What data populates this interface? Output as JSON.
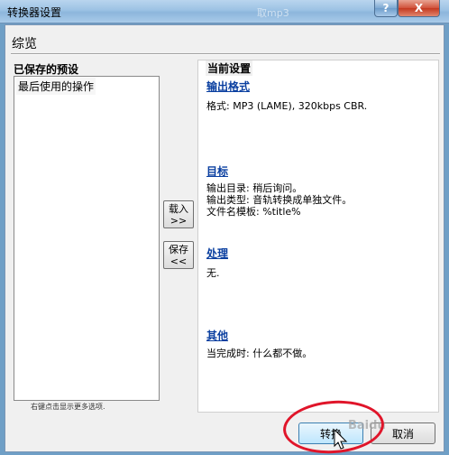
{
  "window": {
    "title": "转换器设置",
    "background_ghost_text": "取mp3",
    "help_label": "?",
    "close_label": "X"
  },
  "overview": {
    "title": "综览"
  },
  "presets": {
    "label": "已保存的预设",
    "items": [
      "最后使用的操作"
    ],
    "hint": "右键点击显示更多选项."
  },
  "side_buttons": {
    "load_line1": "载入",
    "load_line2": ">>",
    "save_line1": "保存",
    "save_line2": "<<"
  },
  "current_settings": {
    "title": "当前设置",
    "output_format": {
      "link": "输出格式",
      "desc": "格式: MP3 (LAME), 320kbps CBR."
    },
    "target": {
      "link": "目标",
      "line1": "输出目录: 稍后询问。",
      "line2": "输出类型: 音轨转换成单独文件。",
      "line3": "文件名模板: %title%"
    },
    "processing": {
      "link": "处理",
      "desc": "无."
    },
    "other": {
      "link": "其他",
      "desc": "当完成时: 什么都不做。"
    }
  },
  "buttons": {
    "convert": "转换",
    "cancel": "取消"
  },
  "watermark": "Baidu",
  "colors": {
    "link": "#0a3fa0",
    "annotation": "#e0152a",
    "titlebar": "#9cc2e4"
  }
}
